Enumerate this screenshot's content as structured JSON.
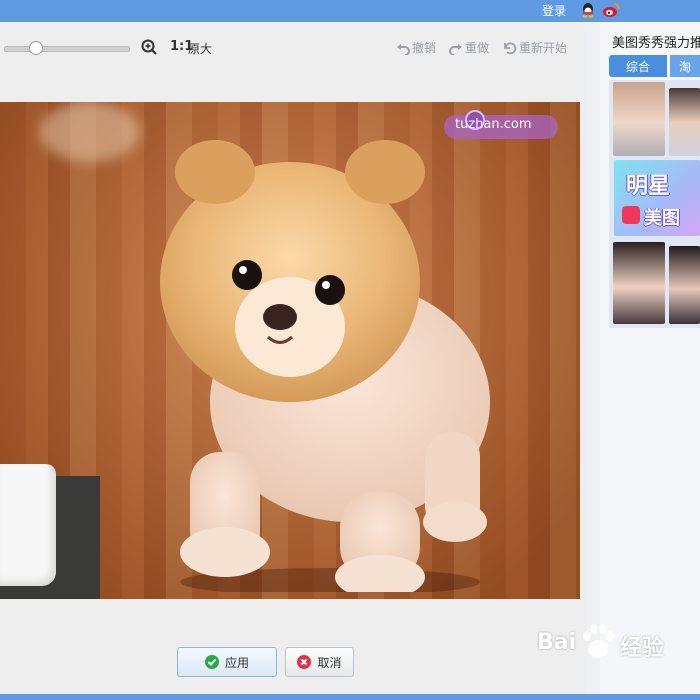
{
  "topbar": {
    "login_label": "登录"
  },
  "toolbar": {
    "ratio_label": "1:1",
    "original_size_label": "原大",
    "undo_label": "撤销",
    "redo_label": "重做",
    "restart_label": "重新开始",
    "zoom_slider_value": 0.25
  },
  "canvas": {
    "watermark_text": "tuzhan.com"
  },
  "actions": {
    "apply_label": "应用",
    "cancel_label": "取消"
  },
  "sidebar": {
    "ad_title": "美图秀秀强力推",
    "tabs": [
      {
        "label": "综合"
      },
      {
        "label": "淘"
      }
    ],
    "banner_line1": "明星",
    "banner_line2": "美图"
  },
  "watermark": {
    "site": "Bai",
    "site_suffix": "经验"
  },
  "colors": {
    "accent": "#5f9be3",
    "tab": "#4a8ee0",
    "apply_icon": "#2aa84a",
    "cancel_icon": "#e0334a"
  }
}
